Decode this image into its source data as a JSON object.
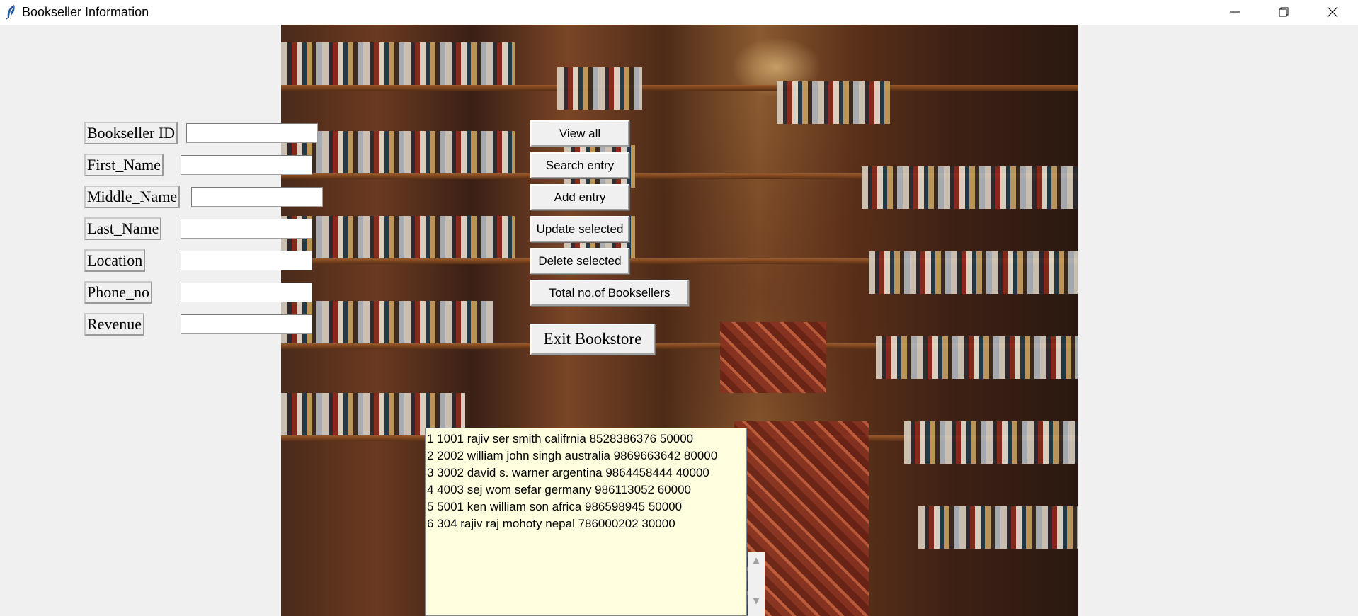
{
  "window": {
    "title": "Bookseller Information",
    "icon": "feather-icon",
    "controls": [
      "minimize",
      "maximize",
      "close"
    ]
  },
  "form": {
    "fields": [
      {
        "label": "Bookseller ID",
        "value": ""
      },
      {
        "label": "First_Name",
        "value": ""
      },
      {
        "label": "Middle_Name",
        "value": ""
      },
      {
        "label": "Last_Name",
        "value": ""
      },
      {
        "label": "Location",
        "value": ""
      },
      {
        "label": "Phone_no",
        "value": ""
      },
      {
        "label": "Revenue",
        "value": ""
      }
    ]
  },
  "buttons": {
    "view_all": "View all",
    "search_entry": "Search entry",
    "add_entry": "Add entry",
    "update_selected": "Update selected",
    "delete_selected": "Delete selected",
    "total_booksellers": "Total no.of Booksellers",
    "exit": "Exit Bookstore"
  },
  "results": {
    "background_color": "#ffffe0",
    "rows": [
      "1 1001 rajiv ser smith califrnia 8528386376 50000",
      "2 2002 william john singh australia 9869663642 80000",
      "3 3002 david s. warner argentina 9864458444 40000",
      "4 4003 sej wom sefar germany 986113052 60000",
      "5 5001 ken william son africa 986598945 50000",
      "6 304 rajiv raj mohoty nepal 786000202 30000"
    ]
  }
}
